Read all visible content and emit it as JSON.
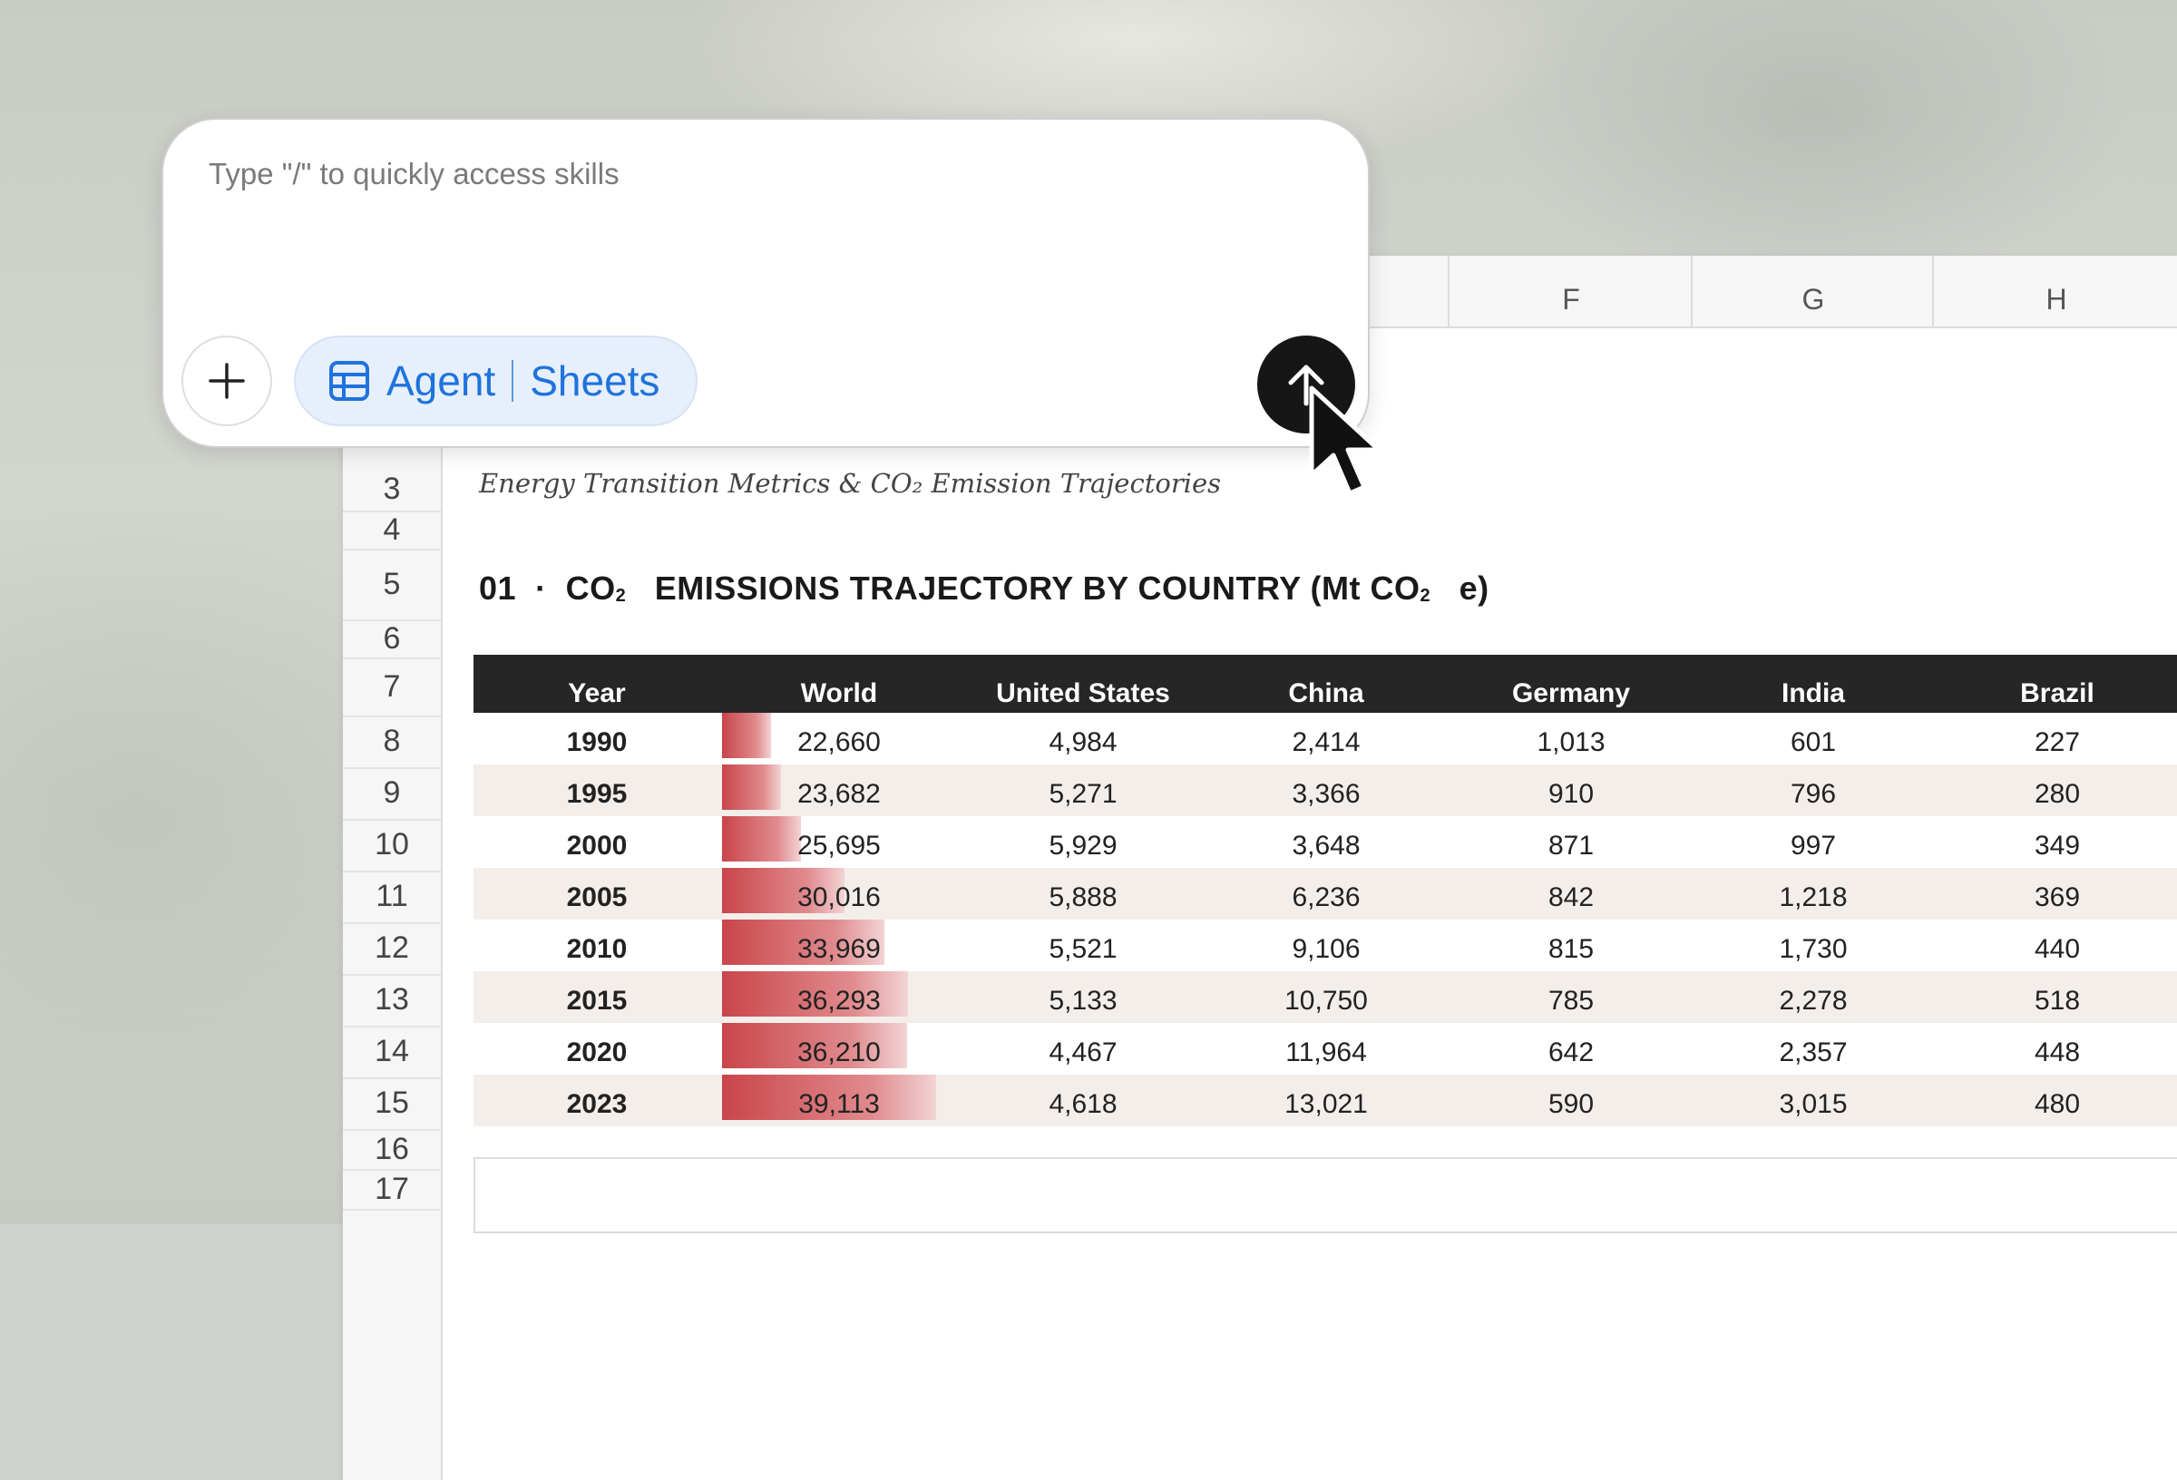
{
  "prompt": {
    "placeholder": "Type \"/\" to quickly access skills",
    "chip_agent": "Agent",
    "chip_mode": "Sheets"
  },
  "sheet": {
    "columns": [
      "F",
      "G",
      "H"
    ],
    "row_numbers": [
      "3",
      "4",
      "5",
      "6",
      "7",
      "8",
      "9",
      "10",
      "11",
      "12",
      "13",
      "14",
      "15",
      "16",
      "17"
    ],
    "subtitle": "Energy Transition Metrics & CO₂ Emission Trajectories",
    "section_number": "01",
    "section_sep": "·",
    "section_co2": "CO",
    "section_co2_sub": "2",
    "section_title_main": "EMISSIONS TRAJECTORY BY COUNTRY (Mt CO",
    "section_title_sub": "2",
    "section_title_end": "e)"
  },
  "table": {
    "headers": [
      "Year",
      "World",
      "United States",
      "China",
      "Germany",
      "India",
      "Brazil"
    ],
    "rows": [
      [
        "1990",
        "22,660",
        "4,984",
        "2,414",
        "1,013",
        "601",
        "227"
      ],
      [
        "1995",
        "23,682",
        "5,271",
        "3,366",
        "910",
        "796",
        "280"
      ],
      [
        "2000",
        "25,695",
        "5,929",
        "3,648",
        "871",
        "997",
        "349"
      ],
      [
        "2005",
        "30,016",
        "5,888",
        "6,236",
        "842",
        "1,218",
        "369"
      ],
      [
        "2010",
        "33,969",
        "5,521",
        "9,106",
        "815",
        "1,730",
        "440"
      ],
      [
        "2015",
        "36,293",
        "5,133",
        "10,750",
        "785",
        "2,278",
        "518"
      ],
      [
        "2020",
        "36,210",
        "4,467",
        "11,964",
        "642",
        "2,357",
        "448"
      ],
      [
        "2023",
        "39,113",
        "4,618",
        "13,021",
        "590",
        "3,015",
        "480"
      ]
    ],
    "world_bar_values": [
      22660,
      23682,
      25695,
      30016,
      33969,
      36293,
      36210,
      39113
    ],
    "bar_color": "#c9454a"
  },
  "colors": {
    "header_bg": "#262626",
    "row_alt": "#f4eeea",
    "chip_accent": "#1f73dc",
    "send_button": "#161616"
  },
  "icons": {
    "add": "plus-icon",
    "chip": "table-grid-icon",
    "send": "arrow-up-icon",
    "pointer": "mouse-pointer-icon"
  }
}
